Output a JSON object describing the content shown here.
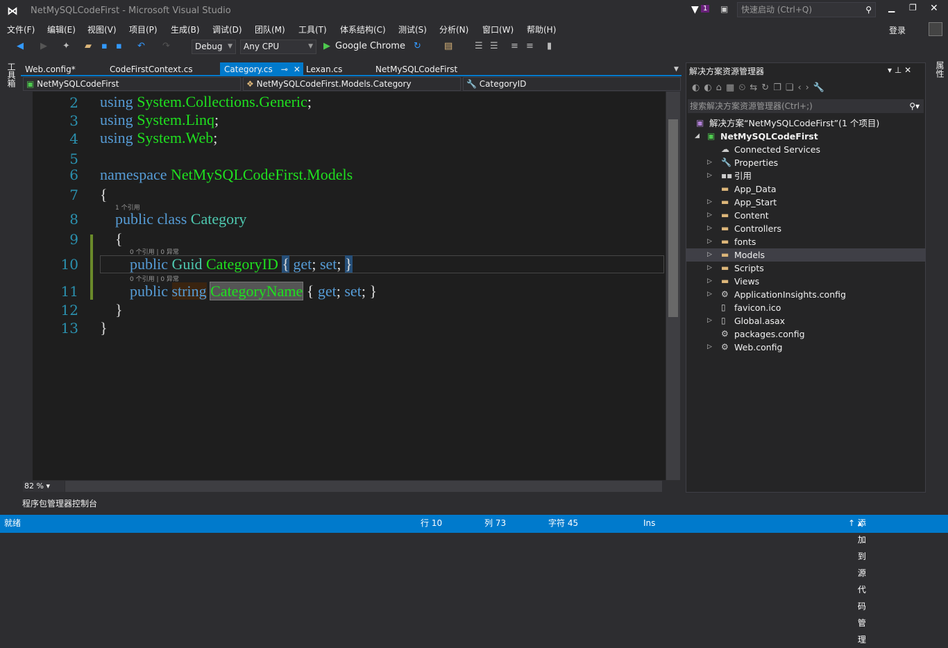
{
  "window": {
    "title": "NetMySQLCodeFirst - Microsoft Visual Studio",
    "quick_launch_placeholder": "快速启动 (Ctrl+Q)",
    "notification_count": "1",
    "sign_in": "登录"
  },
  "menu": [
    "文件(F)",
    "编辑(E)",
    "视图(V)",
    "项目(P)",
    "生成(B)",
    "调试(D)",
    "团队(M)",
    "工具(T)",
    "体系结构(C)",
    "测试(S)",
    "分析(N)",
    "窗口(W)",
    "帮助(H)"
  ],
  "toolbar": {
    "config": "Debug",
    "platform": "Any CPU",
    "run_target": "Google Chrome"
  },
  "left_rail": "工具箱",
  "right_rail": "属性",
  "tabs": [
    {
      "label": "Web.config*"
    },
    {
      "label": "CodeFirstContext.cs"
    },
    {
      "label": "Category.cs",
      "active": true
    },
    {
      "label": "Lexan.cs"
    },
    {
      "label": "NetMySQLCodeFirst"
    }
  ],
  "navbar": {
    "project": "NetMySQLCodeFirst",
    "type": "NetMySQLCodeFirst.Models.Category",
    "member": "CategoryID"
  },
  "code": {
    "line_numbers": [
      "2",
      "3",
      "4",
      "5",
      "6",
      "7",
      "8",
      "9",
      "10",
      "11",
      "12",
      "13"
    ],
    "lens_class": "1 个引用",
    "lens_prop": "0 个引用 | 0 异常",
    "kw_using": "using",
    "kw_namespace": "namespace",
    "kw_public": "public",
    "kw_class": "class",
    "kw_string": "string",
    "kw_get": "get",
    "kw_set": "set",
    "ns1": "System.Collections.Generic",
    "ns2": "System.Linq",
    "ns3": "System.Web",
    "ns_name": "NetMySQLCodeFirst.Models",
    "class_name": "Category",
    "guid": "Guid",
    "prop1": "CategoryID",
    "prop2": "CategoryName"
  },
  "zoom": "82 %",
  "bottom_tab": "程序包管理器控制台",
  "solution_explorer": {
    "title": "解决方案资源管理器",
    "search_placeholder": "搜索解决方案资源管理器(Ctrl+;)",
    "items": [
      {
        "label": "解决方案“NetMySQLCodeFirst”(1 个项目)",
        "icon": "solution-icon"
      },
      {
        "label": "NetMySQLCodeFirst",
        "icon": "web-project-icon",
        "bold": true
      },
      {
        "label": "Connected Services",
        "icon": "cloud-icon"
      },
      {
        "label": "Properties",
        "icon": "wrench-icon"
      },
      {
        "label": "引用",
        "icon": "references-icon"
      },
      {
        "label": "App_Data",
        "icon": "folder-icon"
      },
      {
        "label": "App_Start",
        "icon": "folder-icon"
      },
      {
        "label": "Content",
        "icon": "folder-icon"
      },
      {
        "label": "Controllers",
        "icon": "folder-icon"
      },
      {
        "label": "fonts",
        "icon": "folder-icon"
      },
      {
        "label": "Models",
        "icon": "folder-icon",
        "selected": true
      },
      {
        "label": "Scripts",
        "icon": "folder-icon"
      },
      {
        "label": "Views",
        "icon": "folder-icon"
      },
      {
        "label": "ApplicationInsights.config",
        "icon": "config-icon"
      },
      {
        "label": "favicon.ico",
        "icon": "file-icon"
      },
      {
        "label": "Global.asax",
        "icon": "file-icon"
      },
      {
        "label": "packages.config",
        "icon": "config-icon"
      },
      {
        "label": "Web.config",
        "icon": "config-icon"
      }
    ]
  },
  "status": {
    "ready": "就绪",
    "line": "行 10",
    "col": "列 73",
    "char": "字符 45",
    "mode": "Ins",
    "source_control": "添加到源代码管理"
  }
}
